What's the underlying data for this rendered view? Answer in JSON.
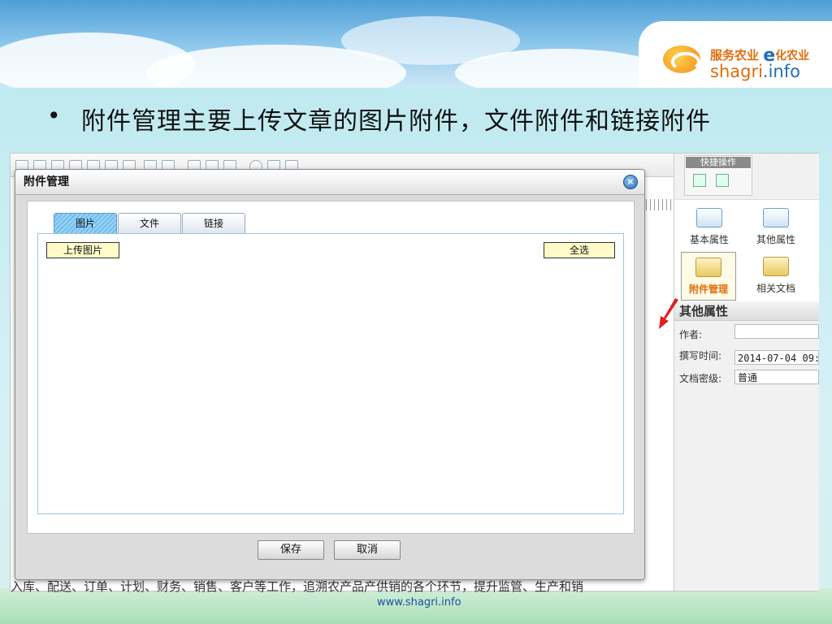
{
  "slide": {
    "bullet_symbol": "•",
    "bullet_text": "附件管理主要上传文章的图片附件，文件附件和链接附件",
    "footer_url": "www.shagri.info"
  },
  "logo": {
    "line1_a": "服务农业",
    "line1_e": "e",
    "line1_b": "化农业",
    "line2_a": "shagri",
    "line2_b": ".info"
  },
  "editor": {
    "body_text": "入库、配送、订单、计划、财务、销售、客户等工作，追溯农产品产供销的各个环节，提升监管、生产和销"
  },
  "dialog": {
    "title": "附件管理",
    "close_symbol": "×",
    "tabs": [
      {
        "label": "图片",
        "active": true
      },
      {
        "label": "文件",
        "active": false
      },
      {
        "label": "链接",
        "active": false
      }
    ],
    "upload_button": "上传图片",
    "select_all_button": "全选",
    "save_button": "保存",
    "cancel_button": "取消"
  },
  "right_panel": {
    "quick_title": "快捷操作",
    "items": [
      {
        "label": "基本属性",
        "icon": "monitor-icon",
        "active": false
      },
      {
        "label": "其他属性",
        "icon": "monitor-settings-icon",
        "active": false
      },
      {
        "label": "附件管理",
        "icon": "paperclip-folder-icon",
        "active": true
      },
      {
        "label": "相关文档",
        "icon": "folder-icon",
        "active": false
      }
    ],
    "other_title": "其他属性",
    "fields": [
      {
        "label": "作者:",
        "value": ""
      },
      {
        "label": "撰写时间:",
        "value": "2014-07-04 09:"
      },
      {
        "label": "文档密级:",
        "value": "普通"
      }
    ]
  },
  "colors": {
    "accent_orange": "#e36c0a",
    "brand_blue": "#1f6fb8",
    "arrow_red": "#e02020"
  }
}
